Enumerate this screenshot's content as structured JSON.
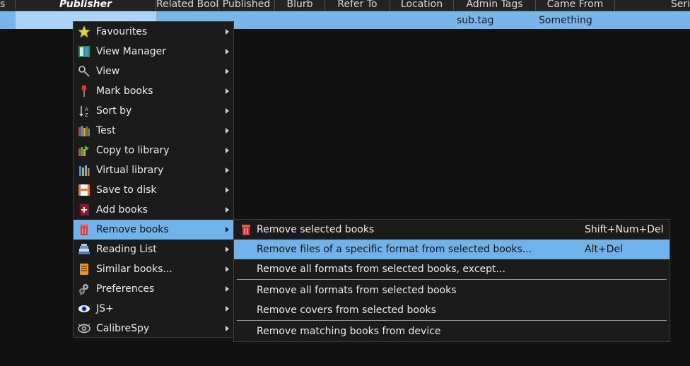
{
  "columns": [
    "s",
    "Publisher",
    "Related Book",
    "Published",
    "Blurb",
    "Refer To",
    "Location",
    "Admin Tags",
    "Came From",
    "Seri"
  ],
  "row": {
    "tags": "sub.tag",
    "came_from": "Something"
  },
  "menu": {
    "items": [
      {
        "label": "Favourites",
        "icon": "star-icon"
      },
      {
        "label": "View Manager",
        "icon": "view-manager-icon"
      },
      {
        "label": "View",
        "icon": "magnifier-icon"
      },
      {
        "label": "Mark books",
        "icon": "pin-icon"
      },
      {
        "label": "Sort by",
        "icon": "sort-icon"
      },
      {
        "label": "Test",
        "icon": "library-books-icon"
      },
      {
        "label": "Copy to library",
        "icon": "copy-library-icon"
      },
      {
        "label": "Virtual library",
        "icon": "virtual-library-icon"
      },
      {
        "label": "Save to disk",
        "icon": "floppy-disk-icon"
      },
      {
        "label": "Add books",
        "icon": "add-book-icon"
      },
      {
        "label": "Remove books",
        "icon": "trash-icon"
      },
      {
        "label": "Reading List",
        "icon": "reading-list-icon"
      },
      {
        "label": "Similar books...",
        "icon": "similar-books-icon"
      },
      {
        "label": "Preferences",
        "icon": "gears-icon"
      },
      {
        "label": "JS+",
        "icon": "eye-icon"
      },
      {
        "label": "CalibreSpy",
        "icon": "spy-eye-icon"
      }
    ],
    "highlighted": "Remove books"
  },
  "submenu": {
    "items": [
      {
        "label": "Remove selected books",
        "shortcut": "Shift+Num+Del",
        "icon": "trash-icon"
      },
      {
        "label": "Remove files of a specific format from selected books...",
        "shortcut": "Alt+Del"
      },
      {
        "label": "Remove all formats from selected books, except...",
        "shortcut": ""
      },
      {
        "label": "Remove all formats from selected books",
        "shortcut": ""
      },
      {
        "label": "Remove covers from selected books",
        "shortcut": ""
      },
      {
        "label": "Remove matching books from device",
        "shortcut": ""
      }
    ],
    "highlighted": "Remove files of a specific format from selected books..."
  },
  "colors": {
    "selection_row": "#7ab6ea",
    "menu_highlight": "#6fb3ea",
    "menu_bg": "#1b1b1b",
    "background": "#121212"
  }
}
